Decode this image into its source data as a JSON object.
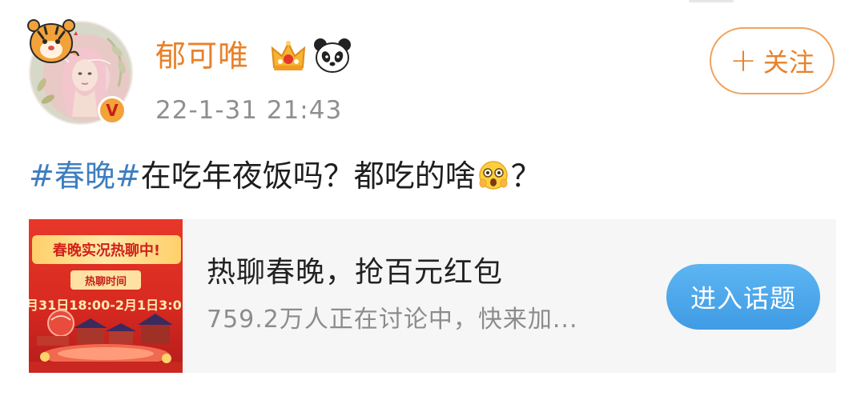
{
  "user": {
    "name": "郁可唯",
    "time": "22-1-31 21:43",
    "badge_letter": "V",
    "badges": [
      "crown-icon",
      "panda-icon"
    ]
  },
  "follow": {
    "plus": "+",
    "label": "关注"
  },
  "post": {
    "topic": "#春晚#",
    "text_before_emoji": "在吃年夜饭吗？都吃的啥",
    "emoji": "shocked-face-emoji",
    "text_after_emoji": "？"
  },
  "card": {
    "banner_title": "春晚实况热聊中!",
    "banner_sub": "热聊时间",
    "banner_time": "月31日18:00-2月1日3:0",
    "title": "热聊春晚，抢百元红包",
    "desc": "759.2万人正在讨论中，快来加...",
    "button": "进入话题"
  },
  "colors": {
    "username": "#e8822a",
    "topic": "#3e7ec0",
    "button_blue": "#4aa6ea",
    "card_bg": "#f6f6f6",
    "banner_red": "#d82a20"
  }
}
